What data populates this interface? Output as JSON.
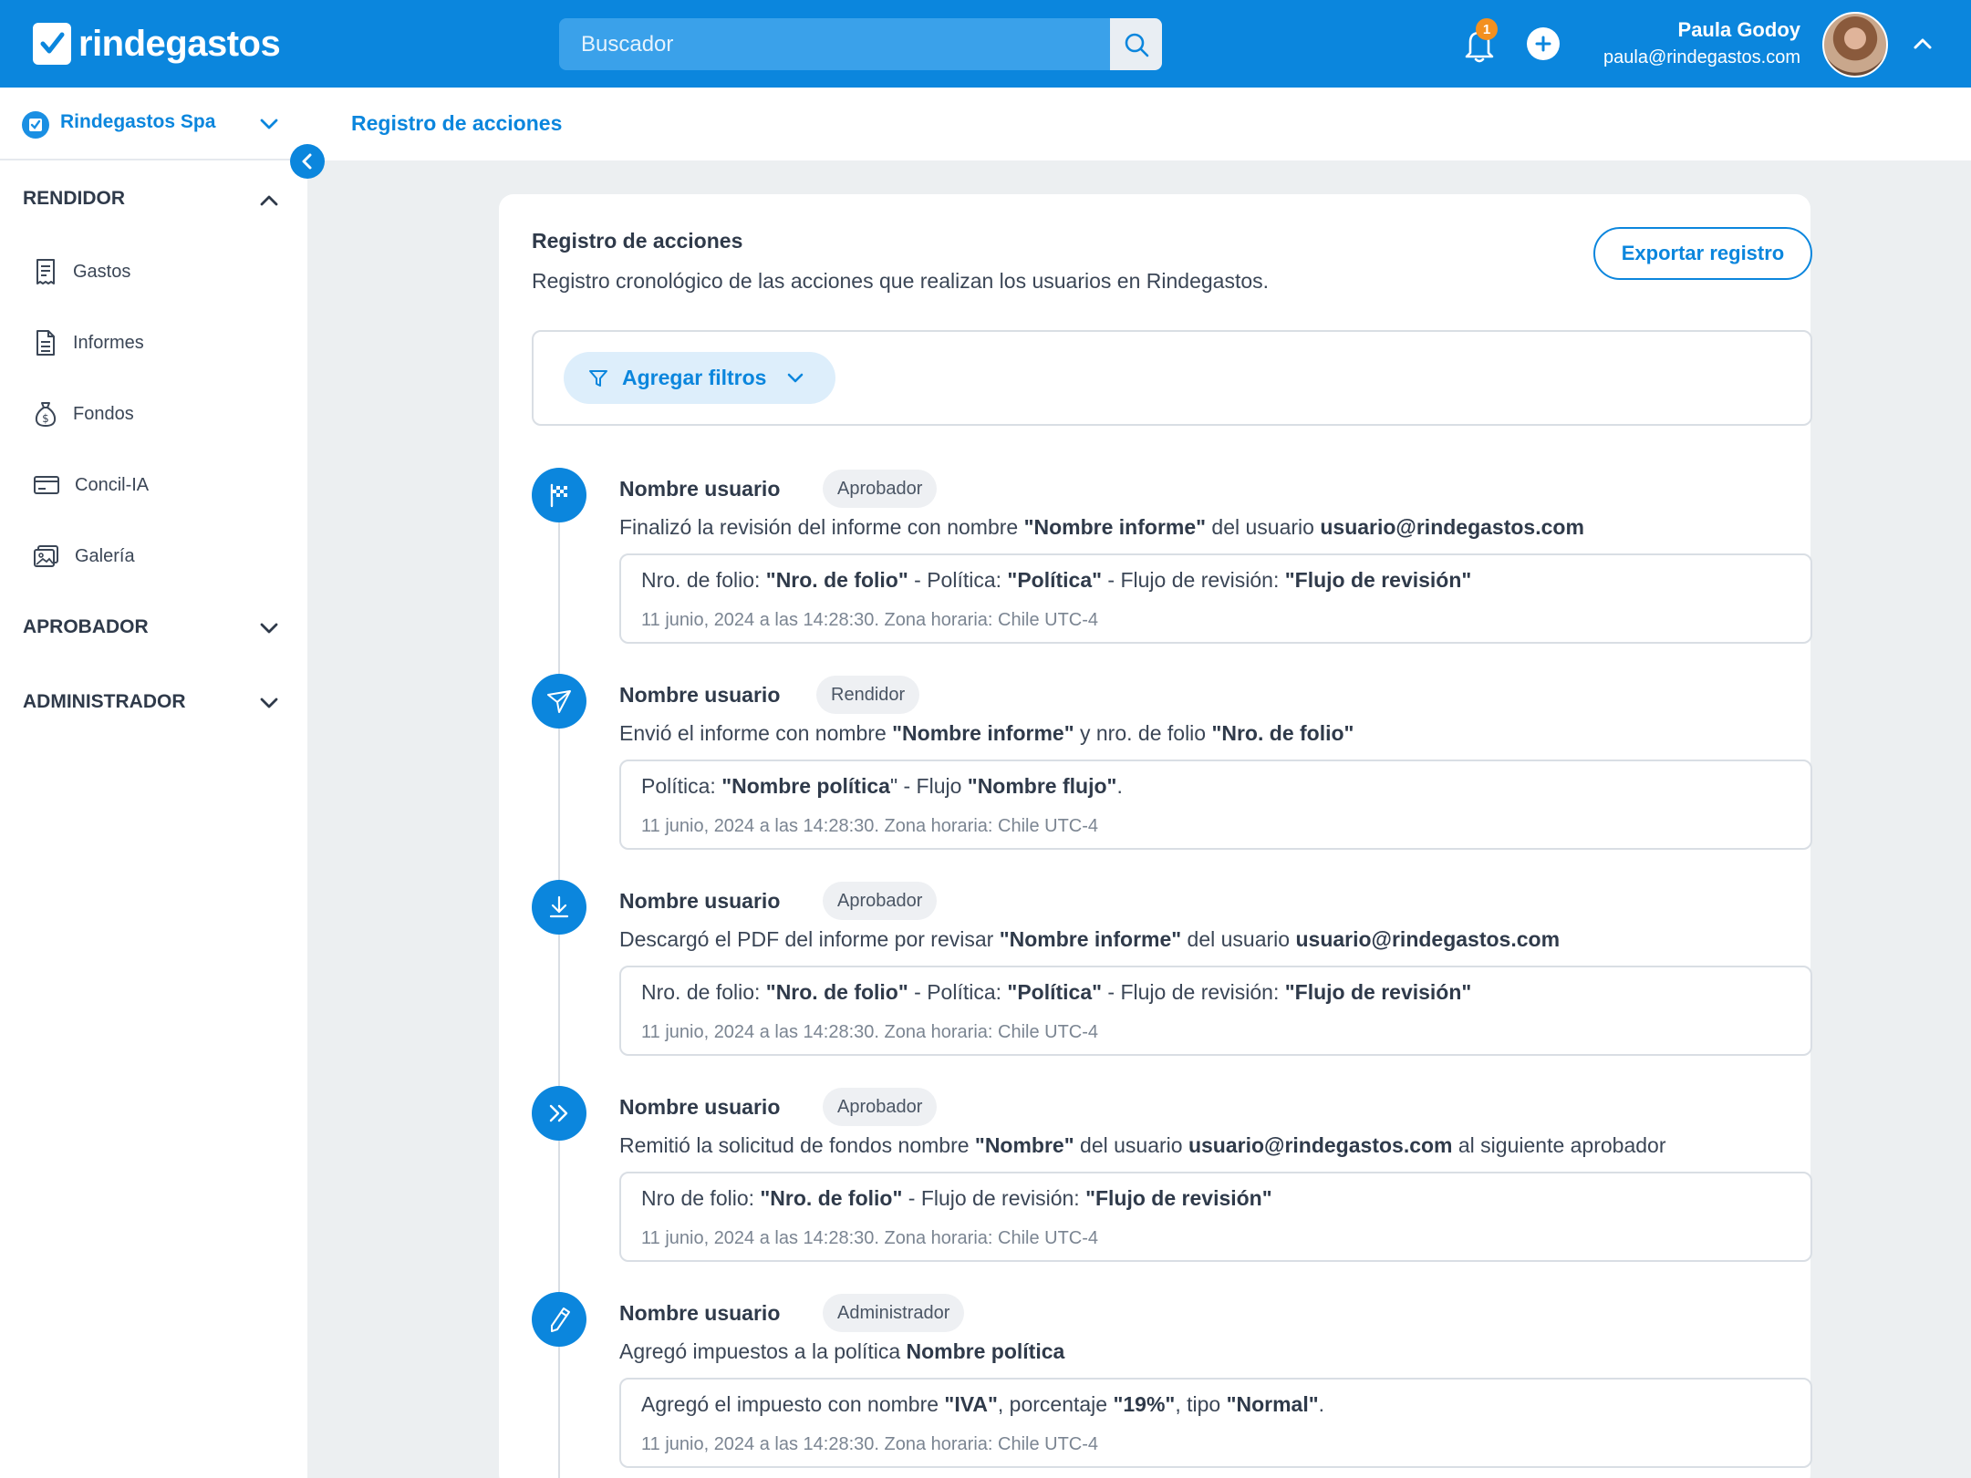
{
  "app": {
    "logo_text": "rindegastos",
    "search_placeholder": "Buscador",
    "notifications_count": "1",
    "user": {
      "name": "Paula Godoy",
      "email": "paula@rindegastos.com"
    }
  },
  "sidebar": {
    "company": "Rindegastos Spa",
    "sections": [
      {
        "label": "RENDIDOR",
        "expanded": true,
        "items": [
          {
            "label": "Gastos",
            "icon": "receipt-icon"
          },
          {
            "label": "Informes",
            "icon": "document-icon"
          },
          {
            "label": "Fondos",
            "icon": "money-bag-icon"
          },
          {
            "label": "Concil-IA",
            "icon": "credit-card-icon"
          },
          {
            "label": "Galería",
            "icon": "gallery-icon"
          }
        ]
      },
      {
        "label": "APROBADOR",
        "expanded": false
      },
      {
        "label": "ADMINISTRADOR",
        "expanded": false
      }
    ]
  },
  "page": {
    "breadcrumb": "Registro de acciones"
  },
  "card": {
    "title": "Registro de acciones",
    "subtitle": "Registro cronológico de las acciones que realizan los usuarios en Rindegastos.",
    "export_label": "Exportar registro",
    "filter_label": "Agregar filtros"
  },
  "entries": [
    {
      "icon": "flag-icon",
      "user": "Nombre usuario",
      "role": "Aprobador",
      "desc": [
        {
          "t": "Finalizó la revisión del informe con nombre ",
          "b": false
        },
        {
          "t": "\"Nombre informe\"",
          "b": true
        },
        {
          "t": " del usuario ",
          "b": false
        },
        {
          "t": "usuario@rindegastos.com",
          "b": true
        }
      ],
      "detail": [
        {
          "t": "Nro. de folio: ",
          "b": false
        },
        {
          "t": "\"Nro. de folio\"",
          "b": true
        },
        {
          "t": " - Política: ",
          "b": false
        },
        {
          "t": "\"Política\"",
          "b": true
        },
        {
          "t": " - Flujo de revisión: ",
          "b": false
        },
        {
          "t": "\"Flujo de revisión\"",
          "b": true
        }
      ],
      "time": "11 junio, 2024 a las 14:28:30. Zona horaria: Chile UTC-4"
    },
    {
      "icon": "send-icon",
      "user": "Nombre usuario",
      "role": "Rendidor",
      "desc": [
        {
          "t": "Envió el informe con nombre ",
          "b": false
        },
        {
          "t": "\"Nombre informe\"",
          "b": true
        },
        {
          "t": " y nro. de folio ",
          "b": false
        },
        {
          "t": "\"Nro. de folio\"",
          "b": true
        }
      ],
      "detail": [
        {
          "t": "Política: ",
          "b": false
        },
        {
          "t": "\"Nombre política",
          "b": true
        },
        {
          "t": "\" - Flujo ",
          "b": false
        },
        {
          "t": "\"Nombre flujo\"",
          "b": true
        },
        {
          "t": ".",
          "b": false
        }
      ],
      "time": "11 junio, 2024 a las 14:28:30. Zona horaria: Chile UTC-4"
    },
    {
      "icon": "download-icon",
      "user": "Nombre usuario",
      "role": "Aprobador",
      "desc": [
        {
          "t": "Descargó el PDF del informe por revisar ",
          "b": false
        },
        {
          "t": "\"Nombre informe\"",
          "b": true
        },
        {
          "t": " del usuario ",
          "b": false
        },
        {
          "t": "usuario@rindegastos.com",
          "b": true
        }
      ],
      "detail": [
        {
          "t": "Nro. de folio: ",
          "b": false
        },
        {
          "t": "\"Nro. de folio\"",
          "b": true
        },
        {
          "t": " - Política: ",
          "b": false
        },
        {
          "t": "\"Política\"",
          "b": true
        },
        {
          "t": " - Flujo de revisión: ",
          "b": false
        },
        {
          "t": "\"Flujo de revisión\"",
          "b": true
        }
      ],
      "time": "11 junio, 2024 a las 14:28:30. Zona horaria: Chile UTC-4"
    },
    {
      "icon": "double-chevron-right-icon",
      "user": "Nombre usuario",
      "role": "Aprobador",
      "desc": [
        {
          "t": "Remitió la solicitud de fondos nombre ",
          "b": false
        },
        {
          "t": "\"Nombre\"",
          "b": true
        },
        {
          "t": " del usuario ",
          "b": false
        },
        {
          "t": "usuario@rindegastos.com",
          "b": true
        },
        {
          "t": " al siguiente aprobador",
          "b": false
        }
      ],
      "detail": [
        {
          "t": "Nro de folio: ",
          "b": false
        },
        {
          "t": "\"Nro. de folio\"",
          "b": true
        },
        {
          "t": " - Flujo de revisión: ",
          "b": false
        },
        {
          "t": "\"Flujo de revisión\"",
          "b": true
        }
      ],
      "time": "11 junio, 2024 a las 14:28:30. Zona horaria: Chile UTC-4"
    },
    {
      "icon": "pencil-icon",
      "user": "Nombre usuario",
      "role": "Administrador",
      "desc": [
        {
          "t": "Agregó impuestos a la política ",
          "b": false
        },
        {
          "t": "Nombre política",
          "b": true
        }
      ],
      "detail": [
        {
          "t": "Agregó el impuesto con nombre ",
          "b": false
        },
        {
          "t": "\"IVA\"",
          "b": true
        },
        {
          "t": ", porcentaje ",
          "b": false
        },
        {
          "t": "\"19%\"",
          "b": true
        },
        {
          "t": ", tipo ",
          "b": false
        },
        {
          "t": "\"Normal\"",
          "b": true
        },
        {
          "t": ".",
          "b": false
        }
      ],
      "time": "11 junio, 2024 a las 14:28:30. Zona horaria: Chile UTC-4"
    }
  ],
  "colors": {
    "primary": "#0b86dd",
    "badge": "#f39020",
    "background": "#eceff1"
  }
}
